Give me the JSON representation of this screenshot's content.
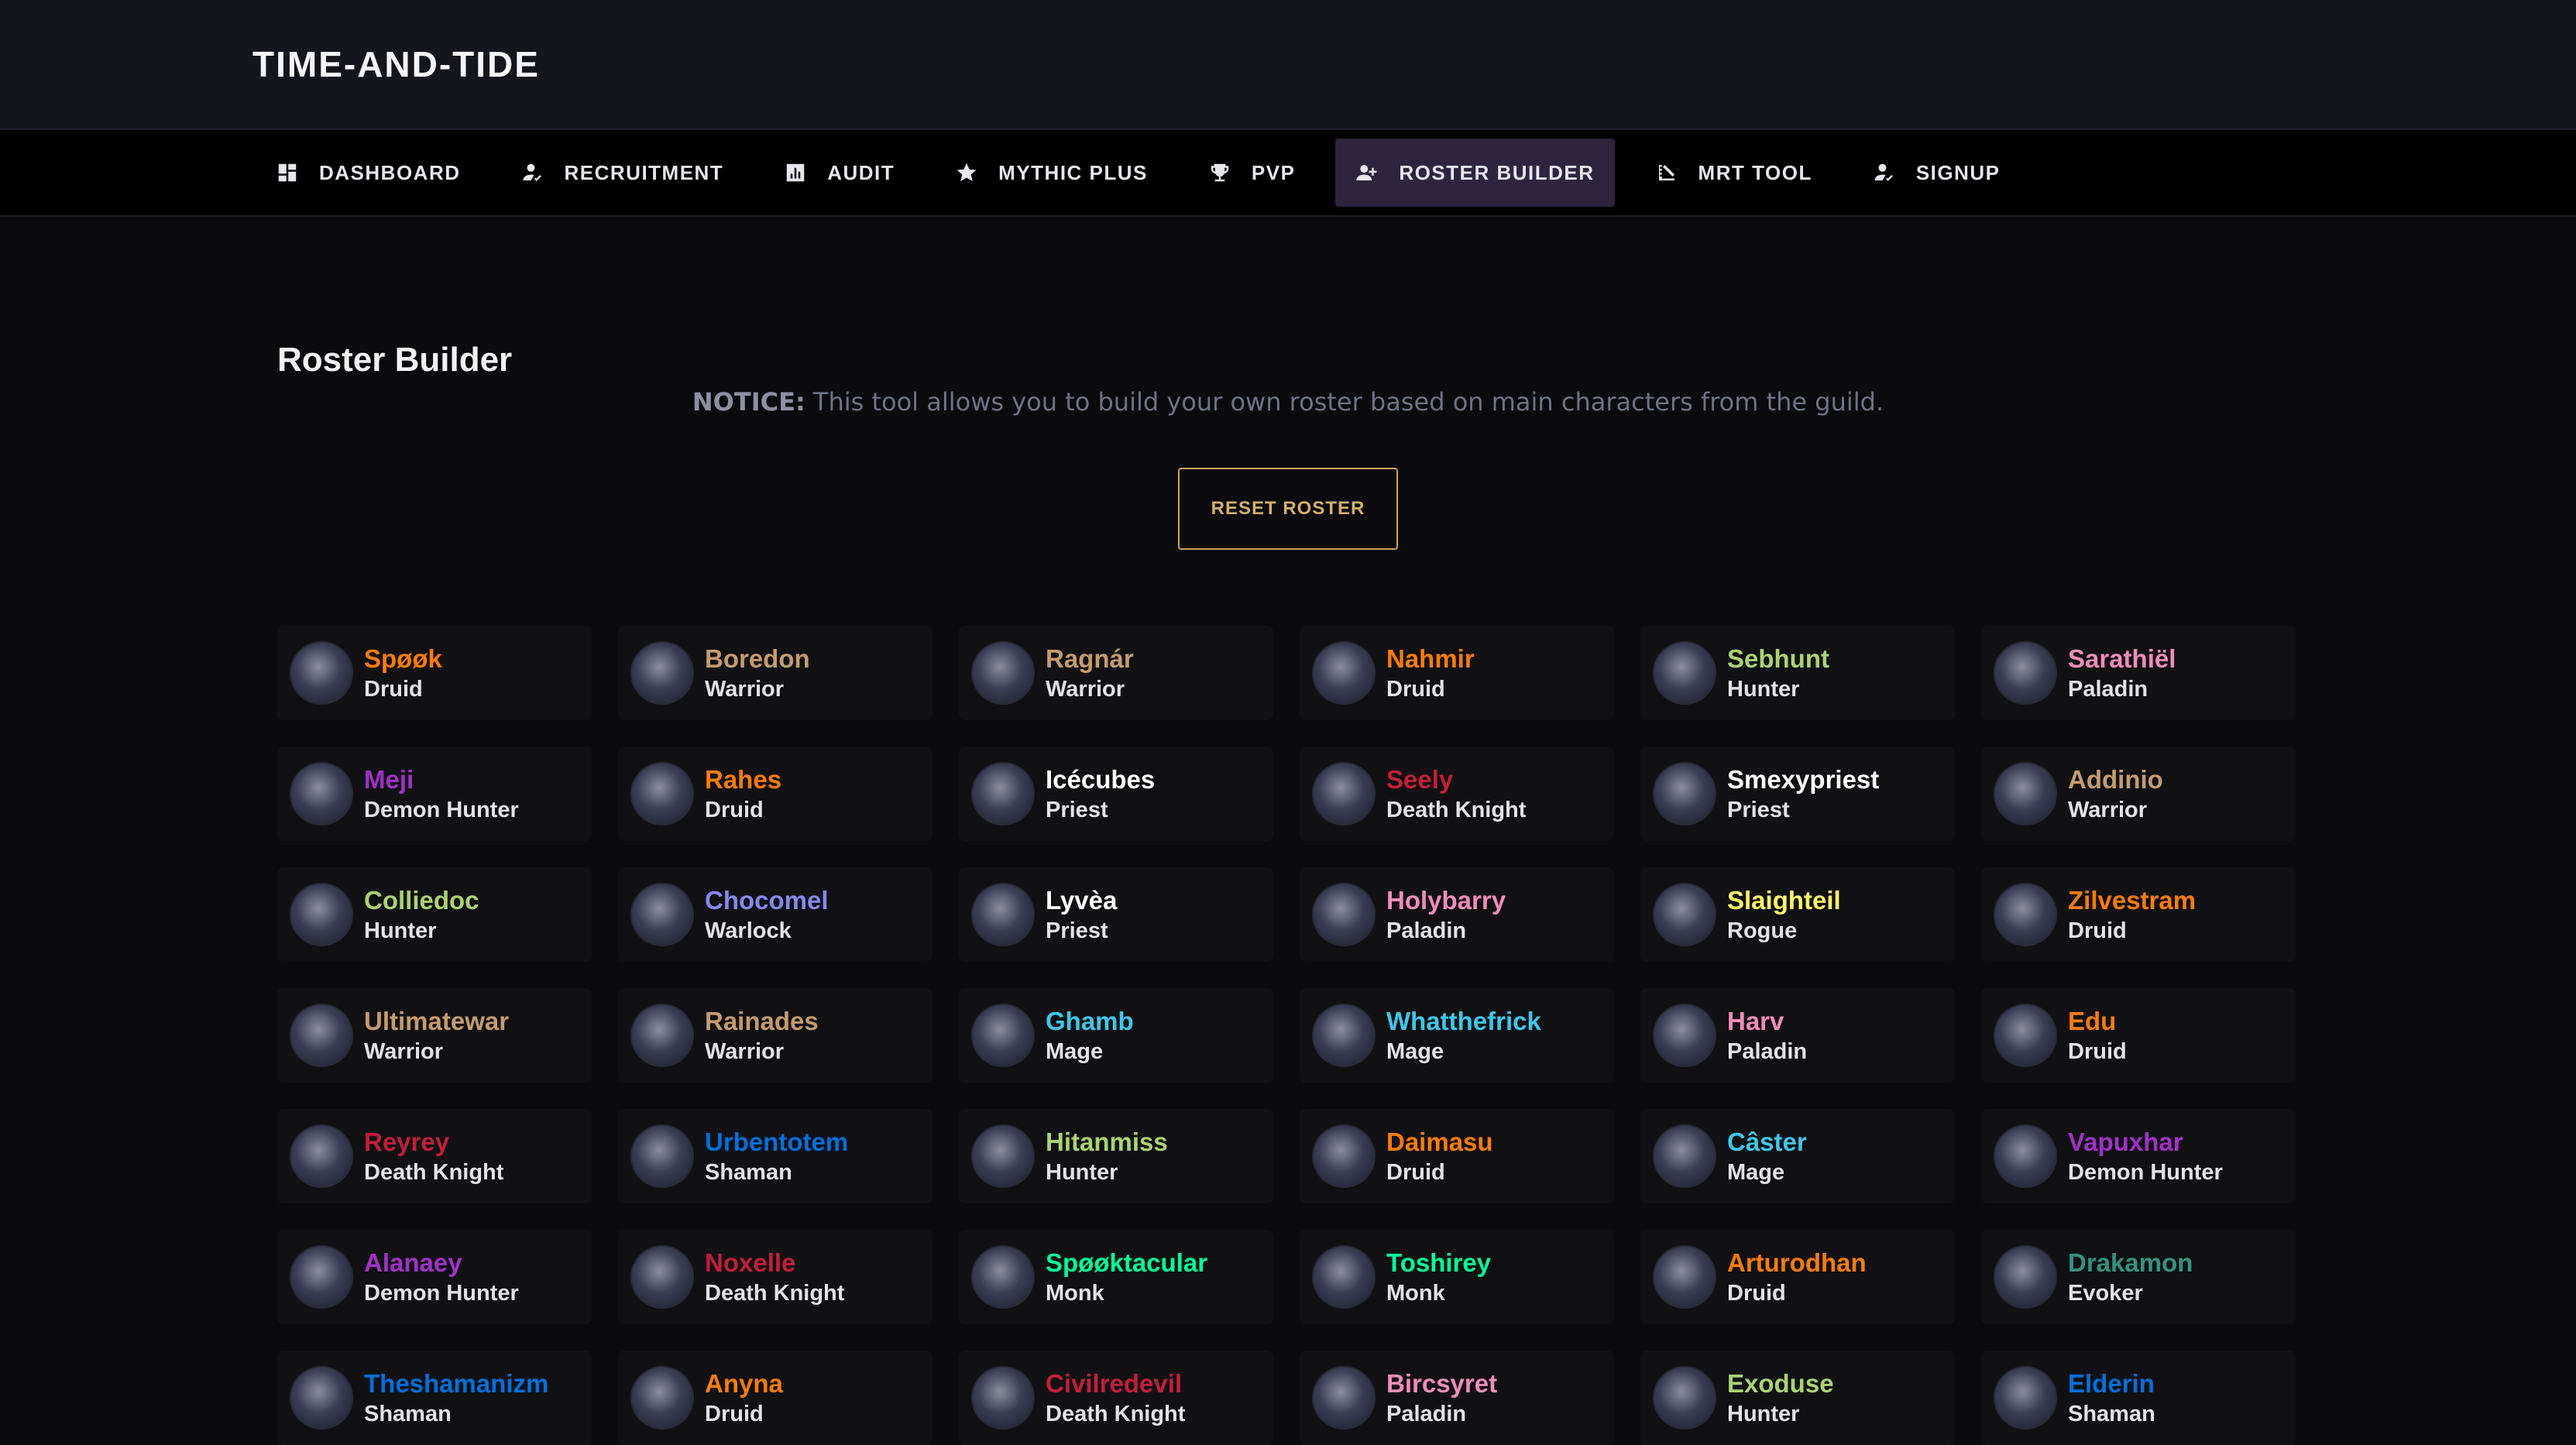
{
  "app": {
    "title": "TIME-AND-TIDE"
  },
  "nav": [
    {
      "label": "DASHBOARD",
      "icon": "dashboard-icon"
    },
    {
      "label": "RECRUITMENT",
      "icon": "person-check-icon"
    },
    {
      "label": "AUDIT",
      "icon": "bar-chart-icon"
    },
    {
      "label": "MYTHIC PLUS",
      "icon": "star-icon"
    },
    {
      "label": "PVP",
      "icon": "trophy-icon"
    },
    {
      "label": "ROSTER BUILDER",
      "icon": "group-add-icon",
      "active": true
    },
    {
      "label": "MRT TOOL",
      "icon": "ruler-icon"
    },
    {
      "label": "SIGNUP",
      "icon": "person-check-icon"
    }
  ],
  "page": {
    "title": "Roster Builder",
    "notice_label": "NOTICE:",
    "notice_text": "This tool allows you to build your own roster based on main characters from the guild.",
    "reset_label": "RESET ROSTER"
  },
  "colors": {
    "Druid": "#ff7c0a",
    "Warrior": "#c69b6d",
    "Hunter": "#aad372",
    "Paladin": "#f48cba",
    "Demon Hunter": "#a330c9",
    "Priest": "#ffffff",
    "Death Knight": "#c41e3a",
    "Warlock": "#8788ee",
    "Rogue": "#fff468",
    "Mage": "#3fc7eb",
    "Shaman": "#0070dd",
    "Monk": "#00ff98",
    "Evoker": "#33937f"
  },
  "characters": [
    {
      "name": "Spøøk",
      "class": "Druid"
    },
    {
      "name": "Boredon",
      "class": "Warrior"
    },
    {
      "name": "Ragnár",
      "class": "Warrior"
    },
    {
      "name": "Nahmir",
      "class": "Druid"
    },
    {
      "name": "Sebhunt",
      "class": "Hunter"
    },
    {
      "name": "Sarathiël",
      "class": "Paladin"
    },
    {
      "name": "Meji",
      "class": "Demon Hunter"
    },
    {
      "name": "Rahes",
      "class": "Druid"
    },
    {
      "name": "Icécubes",
      "class": "Priest"
    },
    {
      "name": "Seely",
      "class": "Death Knight"
    },
    {
      "name": "Smexypriest",
      "class": "Priest"
    },
    {
      "name": "Addinio",
      "class": "Warrior"
    },
    {
      "name": "Colliedoc",
      "class": "Hunter"
    },
    {
      "name": "Chocomel",
      "class": "Warlock"
    },
    {
      "name": "Lyvèa",
      "class": "Priest"
    },
    {
      "name": "Holybarry",
      "class": "Paladin"
    },
    {
      "name": "Slaighteil",
      "class": "Rogue"
    },
    {
      "name": "Zilvestram",
      "class": "Druid"
    },
    {
      "name": "Ultimatewar",
      "class": "Warrior"
    },
    {
      "name": "Rainades",
      "class": "Warrior"
    },
    {
      "name": "Ghamb",
      "class": "Mage"
    },
    {
      "name": "Whatthefrick",
      "class": "Mage"
    },
    {
      "name": "Harv",
      "class": "Paladin"
    },
    {
      "name": "Edu",
      "class": "Druid"
    },
    {
      "name": "Reyrey",
      "class": "Death Knight"
    },
    {
      "name": "Urbentotem",
      "class": "Shaman"
    },
    {
      "name": "Hitanmiss",
      "class": "Hunter"
    },
    {
      "name": "Daimasu",
      "class": "Druid"
    },
    {
      "name": "Câster",
      "class": "Mage"
    },
    {
      "name": "Vapuxhar",
      "class": "Demon Hunter"
    },
    {
      "name": "Alanaey",
      "class": "Demon Hunter"
    },
    {
      "name": "Noxelle",
      "class": "Death Knight"
    },
    {
      "name": "Spøøktacular",
      "class": "Monk"
    },
    {
      "name": "Toshirey",
      "class": "Monk"
    },
    {
      "name": "Arturodhan",
      "class": "Druid"
    },
    {
      "name": "Drakamon",
      "class": "Evoker"
    },
    {
      "name": "Theshamanizm",
      "class": "Shaman"
    },
    {
      "name": "Anyna",
      "class": "Druid"
    },
    {
      "name": "Civilredevil",
      "class": "Death Knight"
    },
    {
      "name": "Bircsyret",
      "class": "Paladin"
    },
    {
      "name": "Exoduse",
      "class": "Hunter"
    },
    {
      "name": "Elderin",
      "class": "Shaman"
    }
  ]
}
